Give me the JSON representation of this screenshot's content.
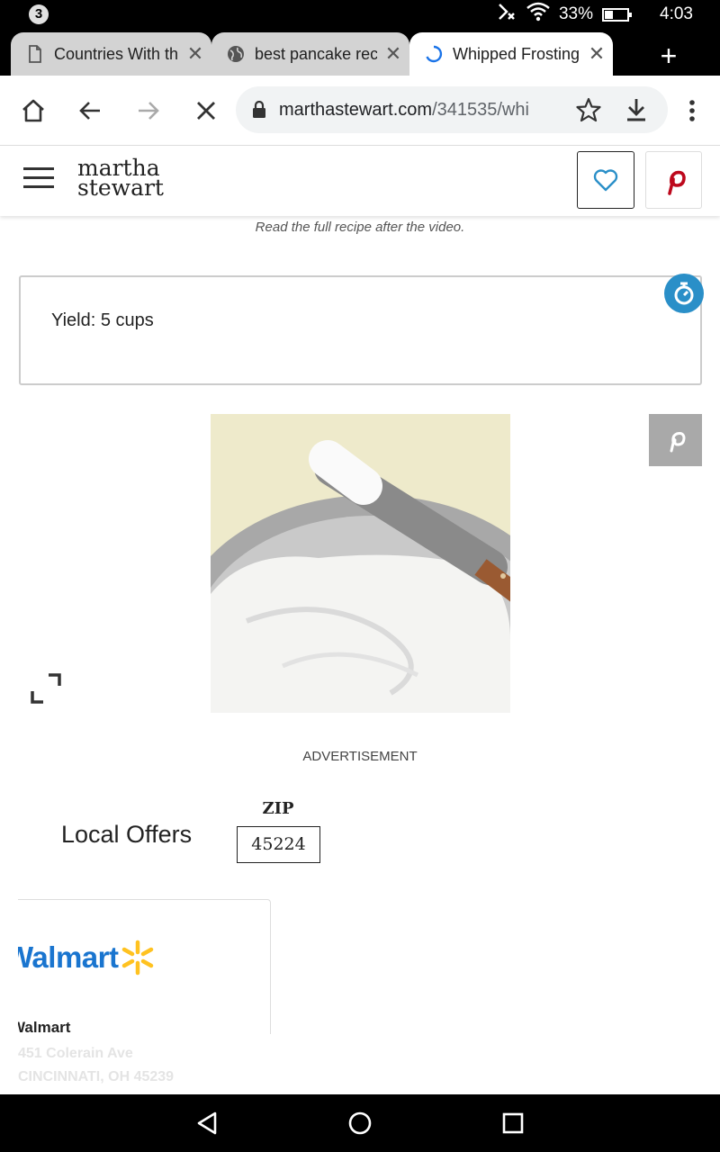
{
  "status": {
    "notification_count": "3",
    "battery_percent": "33%",
    "time": "4:03"
  },
  "tabs": [
    {
      "title": "Countries With th",
      "icon": "page-icon",
      "active": false
    },
    {
      "title": "best pancake rec",
      "icon": "globe-icon",
      "active": false
    },
    {
      "title": "Whipped Frosting",
      "icon": "loading-icon",
      "active": true
    }
  ],
  "toolbar": {
    "url_domain": "marthastewart.com",
    "url_path": "/341535/whi"
  },
  "site": {
    "logo_line1": "martha",
    "logo_line2": "stewart"
  },
  "content": {
    "video_caption": "Read the full recipe after the video.",
    "yield": "Yield: 5 cups",
    "advertisement_label": "ADVERTISEMENT",
    "local_offers_title": "Local Offers",
    "zip_label": "ZIP",
    "zip_value": "45224"
  },
  "offer": {
    "brand": "Walmart",
    "store_name": "Walmart",
    "address_line1": "451 Colerain Ave",
    "address_line2": "CINCINNATI, OH 45239"
  },
  "colors": {
    "pinterest_red": "#bd081c",
    "timer_blue": "#2a8fc8",
    "walmart_blue": "#1a75cf",
    "walmart_yellow": "#ffc220"
  }
}
